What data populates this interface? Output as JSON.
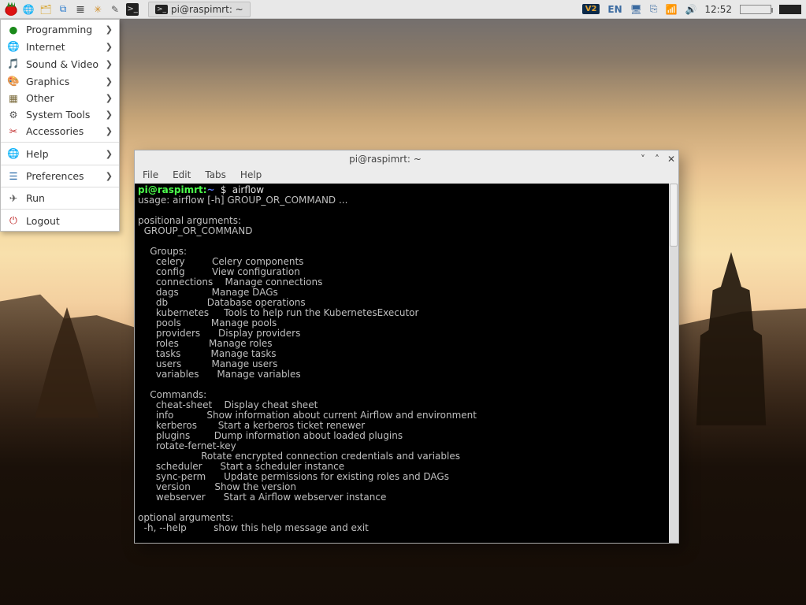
{
  "panel": {
    "task_label": "pi@raspimrt: ~",
    "lang": "EN",
    "clock": "12:52"
  },
  "menu": {
    "items": [
      {
        "icon": "●",
        "color": "#1a8a1a",
        "label": "Programming",
        "arrow": true
      },
      {
        "icon": "🌐",
        "color": "#2a6aa8",
        "label": "Internet",
        "arrow": true
      },
      {
        "icon": "🎵",
        "color": "#c02a2a",
        "label": "Sound & Video",
        "arrow": true
      },
      {
        "icon": "🎨",
        "color": "#c02a2a",
        "label": "Graphics",
        "arrow": true
      },
      {
        "icon": "▦",
        "color": "#7a6a3a",
        "label": "Other",
        "arrow": true
      },
      {
        "icon": "⚙",
        "color": "#555",
        "label": "System Tools",
        "arrow": true
      },
      {
        "icon": "✂",
        "color": "#c02a2a",
        "label": "Accessories",
        "arrow": true
      }
    ],
    "items2": [
      {
        "icon": "🌐",
        "color": "#555",
        "label": "Help",
        "arrow": true
      }
    ],
    "items3": [
      {
        "icon": "☰",
        "color": "#2a6aa8",
        "label": "Preferences",
        "arrow": true
      }
    ],
    "items4": [
      {
        "icon": "✈",
        "color": "#555",
        "label": "Run",
        "arrow": false
      }
    ],
    "items5": [
      {
        "icon": "⏻",
        "color": "#c02a2a",
        "label": "Logout",
        "arrow": false
      }
    ]
  },
  "terminal": {
    "title": "pi@raspimrt: ~",
    "menus": [
      "File",
      "Edit",
      "Tabs",
      "Help"
    ],
    "prompt_host": "pi@raspimrt",
    "prompt_path": "~",
    "prompt_sym": "$",
    "command": "airflow",
    "lines": [
      "usage: airflow [-h] GROUP_OR_COMMAND ...",
      "",
      "positional arguments:",
      "  GROUP_OR_COMMAND",
      "",
      "    Groups:",
      "      celery         Celery components",
      "      config         View configuration",
      "      connections    Manage connections",
      "      dags           Manage DAGs",
      "      db             Database operations",
      "      kubernetes     Tools to help run the KubernetesExecutor",
      "      pools          Manage pools",
      "      providers      Display providers",
      "      roles          Manage roles",
      "      tasks          Manage tasks",
      "      users          Manage users",
      "      variables      Manage variables",
      "",
      "    Commands:",
      "      cheat-sheet    Display cheat sheet",
      "      info           Show information about current Airflow and environment",
      "      kerberos       Start a kerberos ticket renewer",
      "      plugins        Dump information about loaded plugins",
      "      rotate-fernet-key",
      "                     Rotate encrypted connection credentials and variables",
      "      scheduler      Start a scheduler instance",
      "      sync-perm      Update permissions for existing roles and DAGs",
      "      version        Show the version",
      "      webserver      Start a Airflow webserver instance",
      "",
      "optional arguments:",
      "  -h, --help         show this help message and exit"
    ]
  }
}
